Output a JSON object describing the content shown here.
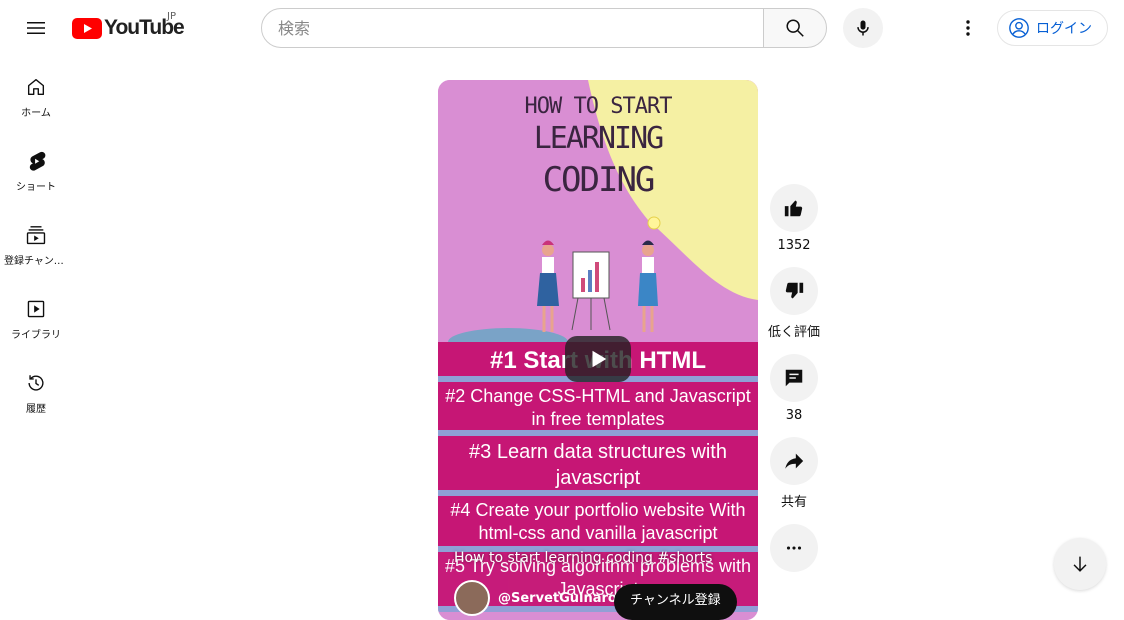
{
  "header": {
    "logo_text": "YouTube",
    "region": "JP",
    "search_placeholder": "検索",
    "login_label": "ログイン"
  },
  "sidebar": {
    "items": [
      {
        "label": "ホーム",
        "icon": "home-icon"
      },
      {
        "label": "ショート",
        "icon": "shorts-icon"
      },
      {
        "label": "登録チャンネル",
        "icon": "subscriptions-icon"
      },
      {
        "label": "ライブラリ",
        "icon": "library-icon"
      },
      {
        "label": "履歴",
        "icon": "history-icon"
      }
    ]
  },
  "short": {
    "thumbnail_heading": [
      "HOW TO START",
      "LEARNING",
      "CODING"
    ],
    "bands": [
      "#1 Start with HTML",
      "#2 Change CSS-HTML and Javascript in free templates",
      "#3 Learn data structures with javascript",
      "#4 Create your portfolio website With html-css and vanilla javascript",
      "#5 Try solving algorithm problems with Javascript"
    ],
    "title": "How to start learning coding #shorts",
    "channel": "@ServetGulnarogl",
    "subscribe_label": "チャンネル登録"
  },
  "actions": {
    "like_count": "1352",
    "dislike_label": "低く評価",
    "comment_count": "38",
    "share_label": "共有"
  },
  "colors": {
    "brand_red": "#ff0000",
    "link_blue": "#065fd4",
    "thumb_pink": "#d98ed3",
    "band_magenta": "#c61675",
    "thumb_yellow": "#f5f0a3"
  }
}
